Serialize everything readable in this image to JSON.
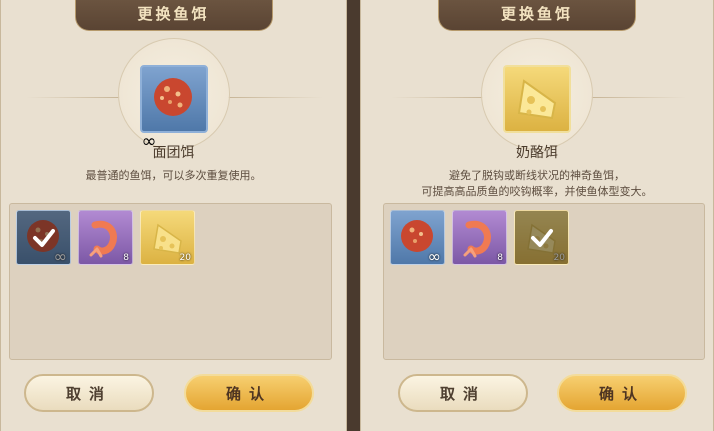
{
  "left": {
    "title": "更换鱼饵",
    "selected_name": "面团饵",
    "selected_desc": "最普通的鱼饵，可以多次重复使用。",
    "selected_badge": "∞",
    "slots": [
      {
        "icon": "dough-ball-bait-icon",
        "badge": "∞",
        "selected": true
      },
      {
        "icon": "shrimp-bait-icon",
        "badge": "8",
        "selected": false
      },
      {
        "icon": "cheese-bait-icon",
        "badge": "20",
        "selected": false
      }
    ],
    "cancel_label": "取消",
    "confirm_label": "确认"
  },
  "right": {
    "title": "更换鱼饵",
    "selected_name": "奶酪饵",
    "selected_desc_line1": "避免了脱钩或断线状况的神奇鱼饵，",
    "selected_desc_line2": "可提高高品质鱼的咬钩概率，并使鱼体型变大。",
    "slots": [
      {
        "icon": "dough-ball-bait-icon",
        "badge": "∞",
        "selected": false
      },
      {
        "icon": "shrimp-bait-icon",
        "badge": "8",
        "selected": false
      },
      {
        "icon": "cheese-bait-icon",
        "badge": "20",
        "selected": true
      }
    ],
    "cancel_label": "取消",
    "confirm_label": "确认"
  },
  "colors": {
    "rarity_blue": "#5f86b8",
    "rarity_purple": "#9a72c0",
    "rarity_gold": "#e7c25a",
    "confirm_button": "#efbd55"
  }
}
